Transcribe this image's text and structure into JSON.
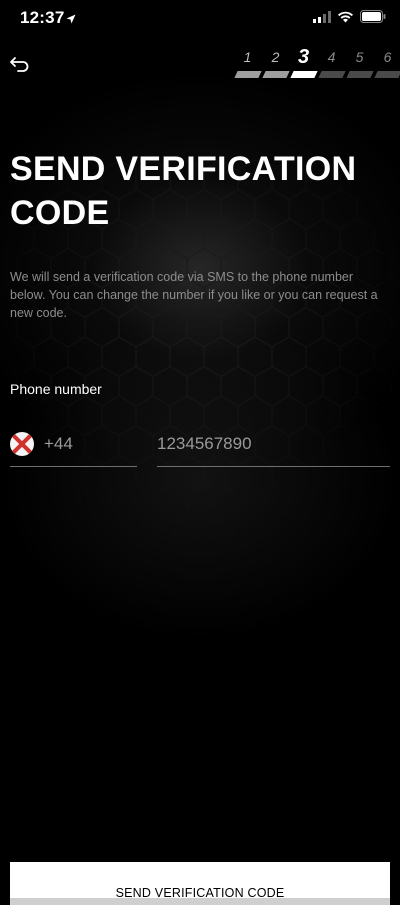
{
  "status_bar": {
    "time": "12:37"
  },
  "steps": [
    {
      "label": "1",
      "state": "done"
    },
    {
      "label": "2",
      "state": "done"
    },
    {
      "label": "3",
      "state": "current"
    },
    {
      "label": "4",
      "state": "upcoming"
    },
    {
      "label": "5",
      "state": "upcoming"
    },
    {
      "label": "6",
      "state": "upcoming"
    }
  ],
  "page": {
    "title": "SEND VERIFICATION CODE",
    "description": "We will send a verification code via SMS to the phone number below. You can change the number if you like or you can request a new code.",
    "phone_label": "Phone number",
    "country_code": "+44",
    "phone_number": "1234567890",
    "send_button": "SEND VERIFICATION CODE"
  },
  "icons": {
    "back": "undo-arrow-icon",
    "flag": "flag-icon",
    "location": "location-arrow-icon",
    "signal": "signal-icon",
    "wifi": "wifi-icon",
    "battery": "battery-icon"
  },
  "colors": {
    "background": "#000000",
    "text": "#ffffff",
    "muted_text": "#8d8d8d",
    "input_text": "#9a9a9a",
    "underline": "#6f6f6f",
    "button_bg": "#ffffff",
    "button_text": "#000000"
  }
}
